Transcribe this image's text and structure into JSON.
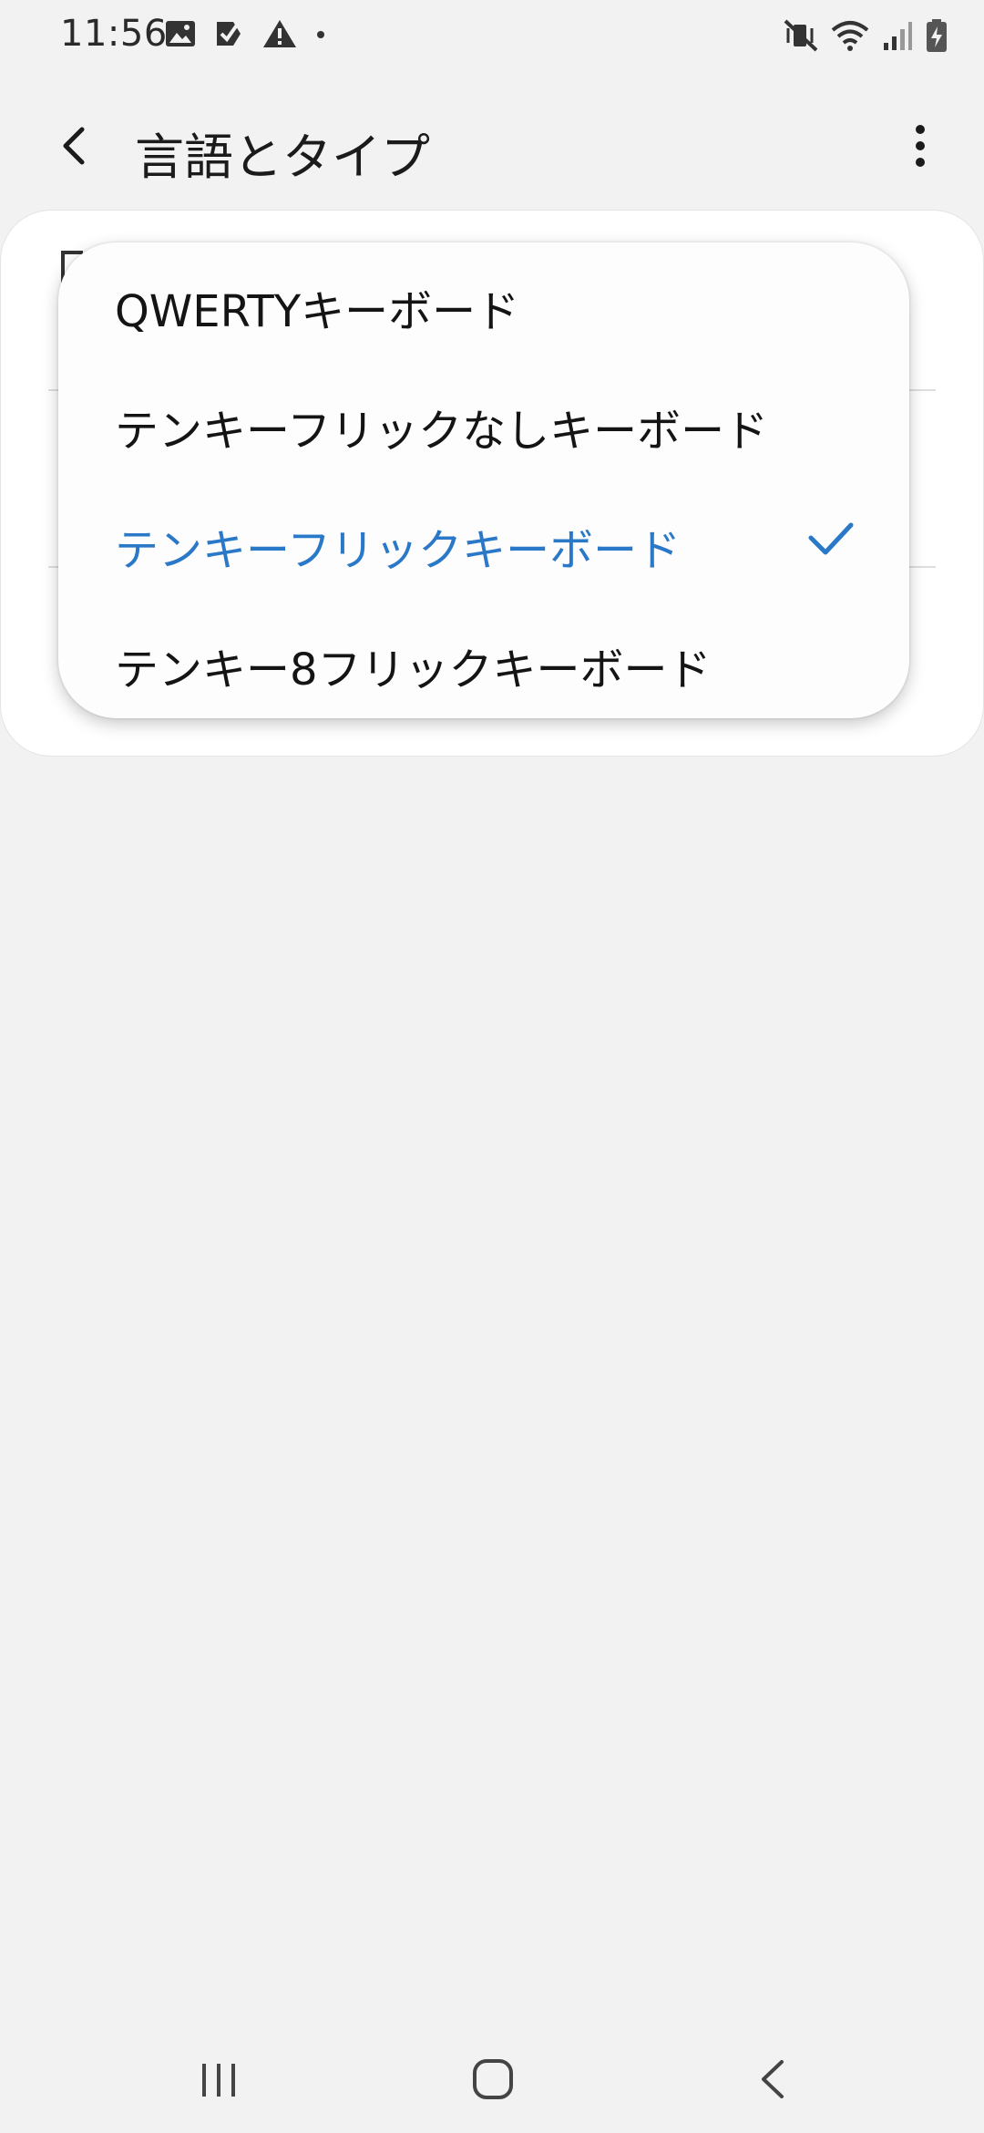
{
  "status_bar": {
    "time": "11:56",
    "left_icons": [
      "gallery-icon",
      "task-check-icon",
      "warning-icon",
      "dot-icon"
    ],
    "right_icons": [
      "vibrate-mute-icon",
      "wifi-icon",
      "signal-icon",
      "battery-charging-icon"
    ]
  },
  "app_bar": {
    "title": "言語とタイプ",
    "back_icon": "chevron-left-icon",
    "more_icon": "more-vertical-icon"
  },
  "popup_menu": {
    "items": [
      {
        "label": "QWERTYキーボード",
        "selected": false
      },
      {
        "label": "テンキーフリックなしキーボード",
        "selected": false
      },
      {
        "label": "テンキーフリックキーボード",
        "selected": true
      },
      {
        "label": "テンキー8フリックキーボード",
        "selected": false
      }
    ]
  },
  "nav_bar": {
    "icons": [
      "recent-apps-icon",
      "home-icon",
      "back-icon"
    ]
  },
  "colors": {
    "background": "#f2f2f2",
    "card": "#ffffff",
    "accent": "#2a78c8",
    "text": "#141414"
  }
}
